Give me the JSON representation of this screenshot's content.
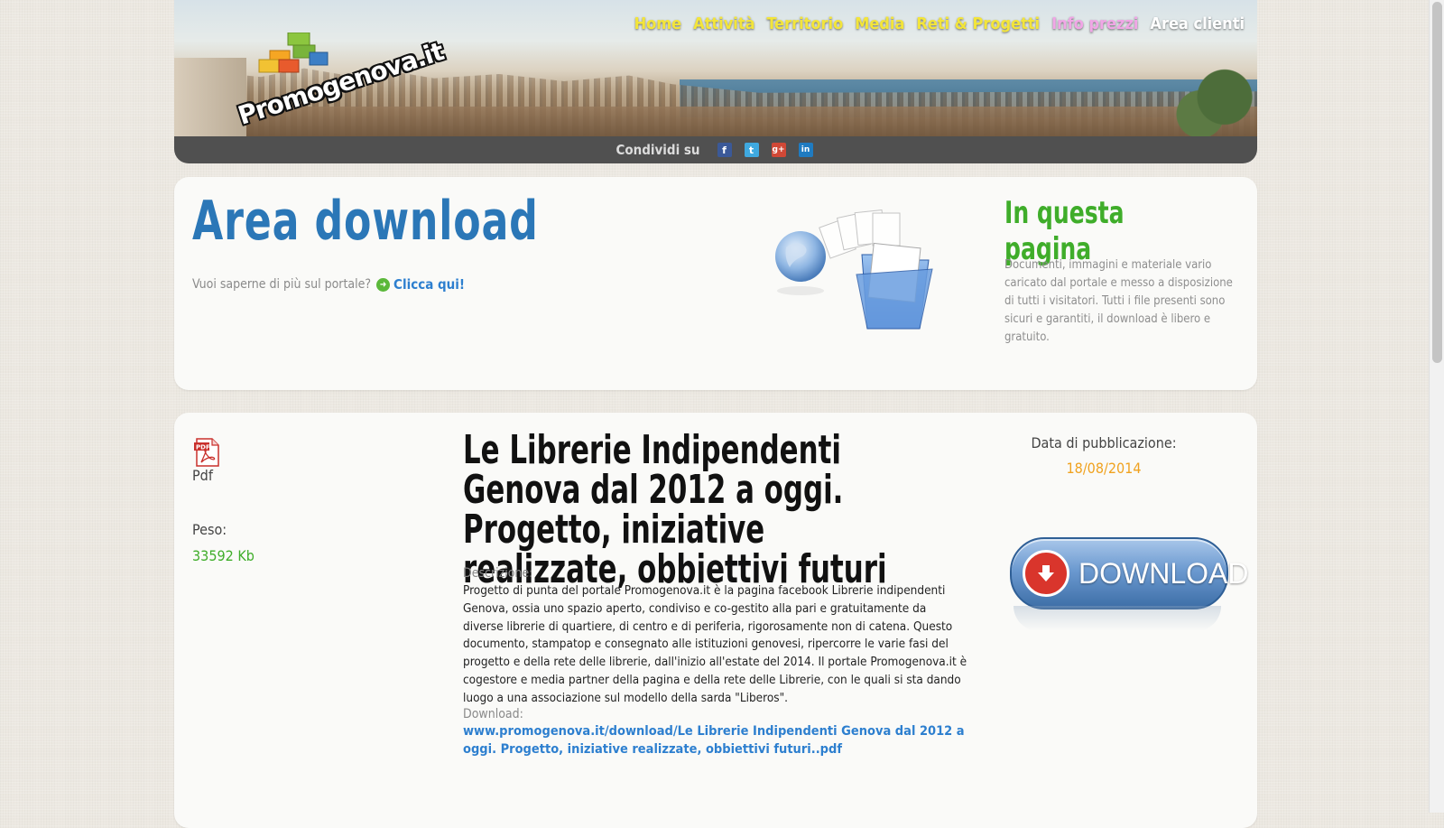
{
  "site": {
    "brand": "Promogenova.it"
  },
  "nav": {
    "items": [
      {
        "label": "Home"
      },
      {
        "label": "Attività"
      },
      {
        "label": "Territorio"
      },
      {
        "label": "Media"
      },
      {
        "label": "Reti & Progetti"
      },
      {
        "label": "Info prezzi"
      },
      {
        "label": "Area clienti"
      }
    ],
    "colors": {
      "default": "#f3e53a",
      "info_prezzi": "#f1a6e6",
      "area_clienti": "#ffffff"
    }
  },
  "share": {
    "label": "Condividi su",
    "icons": [
      "facebook-icon",
      "twitter-icon",
      "google-plus-icon",
      "linkedin-icon"
    ]
  },
  "intro": {
    "title": "Area download",
    "more_text": "Vuoi saperne di più sul portale?",
    "more_link": "Clicca qui!",
    "side_title": "In questa pagina",
    "side_text": "Documenti, immagini e materiale vario caricato dal portale e messo a disposizione di tutti i visitatori. Tutti i file presenti sono sicuri e garantiti, il download è libero e gratuito."
  },
  "document": {
    "file_type": "Pdf",
    "weight_label": "Peso:",
    "weight_value": "33592 Kb",
    "title": "Le Librerie Indipendenti Genova dal 2012 a oggi. Progetto, iniziative realizzate, obbiettivi futuri",
    "description_label": "Descrizione:",
    "description": "Progetto di punta del portale Promogenova.it è la pagina facebook Librerie indipendenti Genova, ossia uno spazio aperto, condiviso e co-gestito alla pari e gratuitamente da diverse librerie di quartiere, di centro e di periferia, rigorosamente non di catena. Questo documento, stampatop e consegnato alle istituzioni genovesi, ripercorre le varie fasi del progetto e della rete delle librerie, dall'inizio all'estate del 2014. Il portale Promogenova.it è cogestore e media partner della pagina e della rete delle Librerie, con le quali si sta dando luogo a una associazione sul modello della sarda \"Liberos\".",
    "download_label": "Download:",
    "download_link": "www.promogenova.it/download/Le Librerie Indipendenti Genova dal 2012 a oggi. Progetto, iniziative realizzate, obbiettivi futuri..pdf",
    "pub_label": "Data di pubblicazione:",
    "pub_date": "18/08/2014",
    "download_button": "DOWNLOAD"
  },
  "colors": {
    "title_blue": "#2b77b7",
    "green": "#3fad2a",
    "orange": "#f0a21f",
    "link_blue": "#2d7fcf"
  }
}
